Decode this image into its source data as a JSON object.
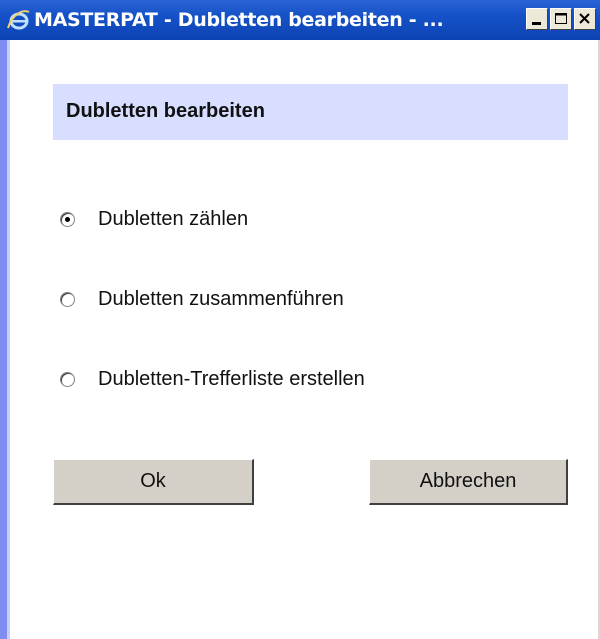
{
  "window": {
    "title": "MASTERPAT - Dubletten bearbeiten - ...",
    "icon": "ie-icon",
    "controls": [
      "minimize-icon",
      "maximize-icon",
      "close-icon"
    ]
  },
  "dialog": {
    "header": "Dubletten bearbeiten",
    "options": [
      {
        "label": "Dubletten zählen",
        "selected": true
      },
      {
        "label": "Dubletten zusammenführen",
        "selected": false
      },
      {
        "label": "Dubletten-Trefferliste erstellen",
        "selected": false
      }
    ],
    "ok_label": "Ok",
    "cancel_label": "Abbrechen"
  },
  "colors": {
    "titlebar": "#1551c7",
    "header_bg": "#d7deff",
    "left_border": "#7f8cf0",
    "button_face": "#d4d0c8"
  }
}
